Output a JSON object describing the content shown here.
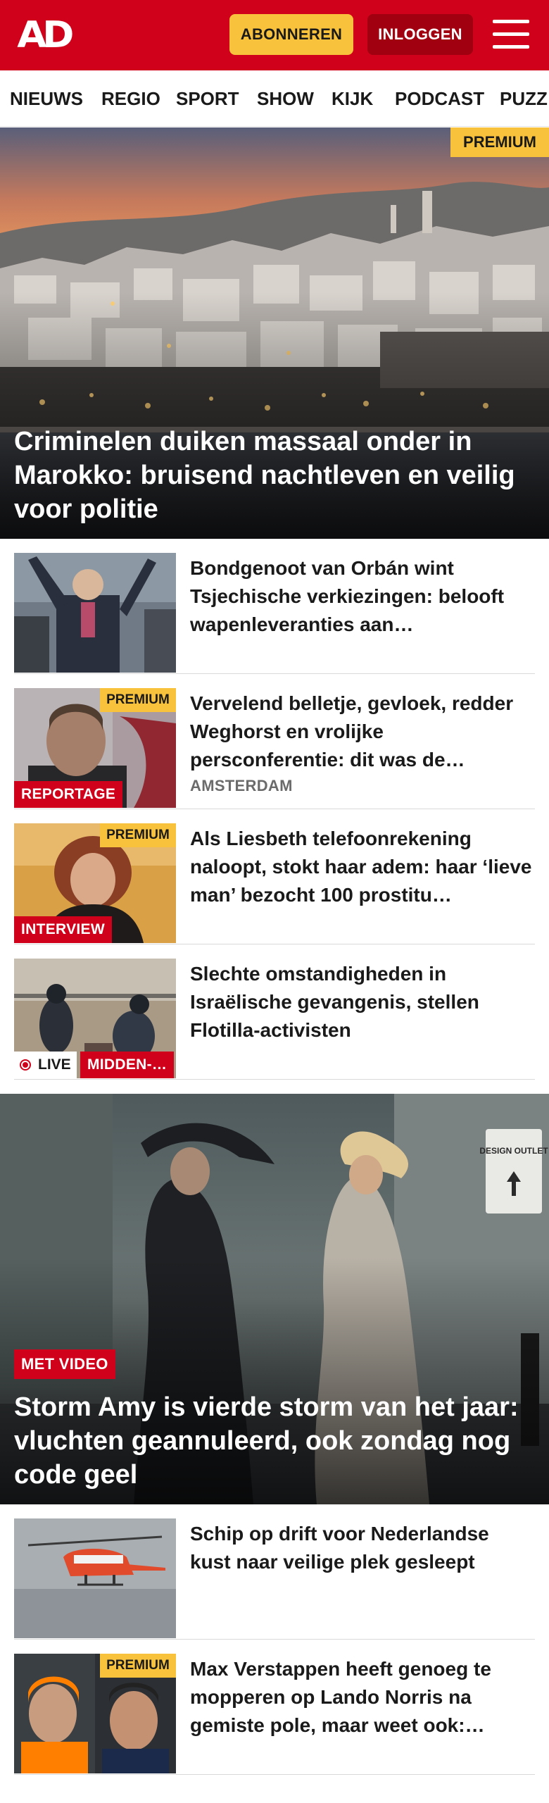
{
  "header": {
    "logo_text": "AD",
    "subscribe_label": "ABONNEREN",
    "login_label": "INLOGGEN"
  },
  "nav": {
    "items": [
      "NIEUWS",
      "REGIO",
      "SPORT",
      "SHOW",
      "KIJK",
      "PODCAST",
      "PUZZ"
    ]
  },
  "hero1": {
    "premium_label": "PREMIUM",
    "title": "Criminelen duiken massaal onder in Marokko: bruisend nachtleven en veilig voor politie"
  },
  "articles1": [
    {
      "headline": "Bondgenoot van Orbán wint Tsjechische verkiezingen: belooft wapenleveranties aan…"
    },
    {
      "premium_label": "PREMIUM",
      "tag": "REPORTAGE",
      "headline": "Vervelend belletje, gevloek, redder Weghorst en vrolijke persconferentie: dit was de…",
      "location": "AMSTERDAM"
    },
    {
      "premium_label": "PREMIUM",
      "tag": "INTERVIEW",
      "headline": "Als Liesbeth telefoonrekening naloopt, stokt haar adem: haar ‘lieve man’ bezocht 100 prostitu…"
    },
    {
      "live_label": "LIVE",
      "tag": "MIDDEN-…",
      "headline": "Slechte omstandigheden in Israëlische gevangenis, stellen Flotilla-activisten"
    }
  ],
  "hero2": {
    "tag": "MET VIDEO",
    "sign_text": "DESIGN OUTLET",
    "title": "Storm Amy is vierde storm van het jaar: vluchten geannuleerd, ook zondag nog code geel"
  },
  "articles2": [
    {
      "headline": "Schip op drift voor Nederlandse kust naar veilige plek gesleept"
    },
    {
      "premium_label": "PREMIUM",
      "headline": "Max Verstappen heeft genoeg te mopperen op Lando Norris na gemiste pole, maar weet ook:…"
    }
  ],
  "colors": {
    "brand_red": "#d0021b",
    "premium_yellow": "#f9c23c",
    "login_dark_red": "#a0000f"
  },
  "icons": {
    "menu": "hamburger-menu-icon",
    "live": "live-dot-icon"
  }
}
